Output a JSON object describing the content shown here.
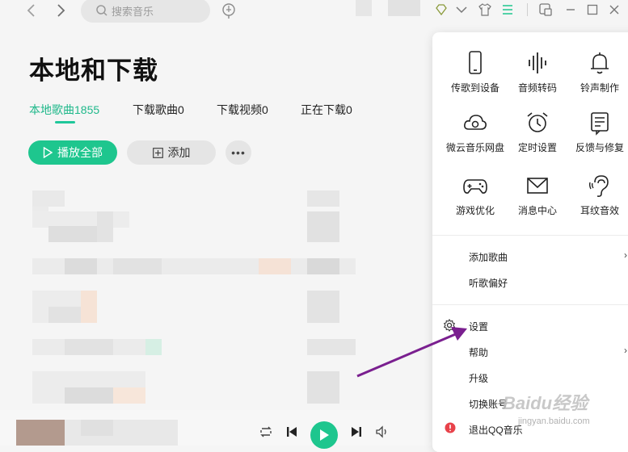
{
  "search": {
    "placeholder": "搜索音乐"
  },
  "page": {
    "title": "本地和下载"
  },
  "tabs": [
    {
      "label": "本地歌曲1855",
      "active": true
    },
    {
      "label": "下载歌曲0"
    },
    {
      "label": "下载视频0"
    },
    {
      "label": "正在下载0"
    }
  ],
  "actions": {
    "play_all": "播放全部",
    "add": "添加"
  },
  "menu": {
    "grid": [
      {
        "label": "传歌到设备",
        "icon": "phone-icon"
      },
      {
        "label": "音频转码",
        "icon": "audio-wave-icon"
      },
      {
        "label": "铃声制作",
        "icon": "bell-icon"
      },
      {
        "label": "微云音乐网盘",
        "icon": "cloud-icon"
      },
      {
        "label": "定时设置",
        "icon": "alarm-clock-icon"
      },
      {
        "label": "反馈与修复",
        "icon": "feedback-icon"
      },
      {
        "label": "游戏优化",
        "icon": "gamepad-icon"
      },
      {
        "label": "消息中心",
        "icon": "mail-icon"
      },
      {
        "label": "耳纹音效",
        "icon": "ear-icon"
      }
    ],
    "items": [
      {
        "label": "添加歌曲",
        "submenu": true
      },
      {
        "label": "听歌偏好"
      },
      {
        "label": "设置",
        "icon": "gear-icon"
      },
      {
        "label": "帮助",
        "submenu": true
      },
      {
        "label": "升级"
      },
      {
        "label": "切换账号"
      },
      {
        "label": "退出QQ音乐",
        "icon": "exit-icon"
      }
    ]
  },
  "watermark": {
    "brand": "Baidu经验",
    "url": "jingyan.baidu.com"
  },
  "colors": {
    "accent": "#1ec68e",
    "annotation_arrow": "#7a1f8f"
  }
}
